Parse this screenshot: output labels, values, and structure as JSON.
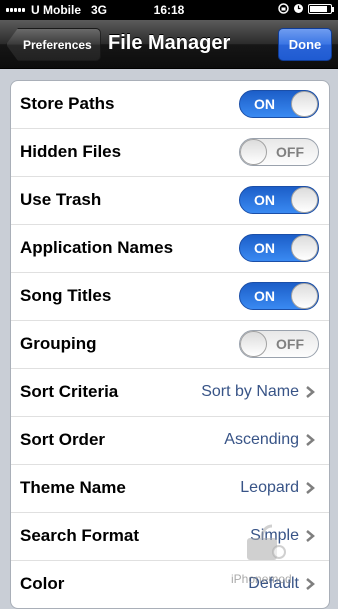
{
  "status_bar": {
    "carrier": "U Mobile",
    "network": "3G",
    "time": "16:18",
    "battery_level": 0.85
  },
  "nav": {
    "back_label": "Preferences",
    "title": "File Manager",
    "done_label": "Done"
  },
  "toggles": [
    {
      "label": "Store Paths",
      "state": "ON"
    },
    {
      "label": "Hidden Files",
      "state": "OFF"
    },
    {
      "label": "Use Trash",
      "state": "ON"
    },
    {
      "label": "Application Names",
      "state": "ON"
    },
    {
      "label": "Song Titles",
      "state": "ON"
    },
    {
      "label": "Grouping",
      "state": "OFF"
    }
  ],
  "options": [
    {
      "label": "Sort Criteria",
      "value": "Sort by Name"
    },
    {
      "label": "Sort Order",
      "value": "Ascending"
    },
    {
      "label": "Theme Name",
      "value": "Leopard"
    },
    {
      "label": "Search Format",
      "value": "Simple"
    },
    {
      "label": "Color",
      "value": "Default"
    }
  ],
  "watermark": "iPhonemod",
  "colors": {
    "accent_blue": "#2a64d8",
    "switch_on": "#2d7ce8",
    "value_text": "#385487",
    "background": "#c9ced6"
  }
}
